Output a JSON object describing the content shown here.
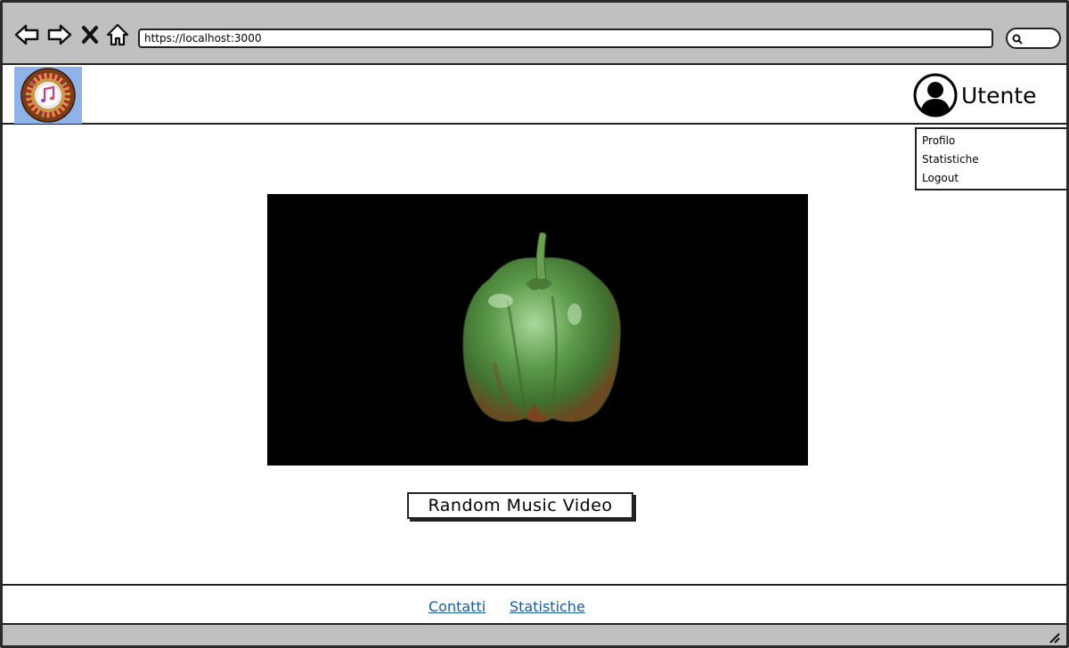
{
  "browser": {
    "url": "https://localhost:3000",
    "icons": [
      "back-arrow-icon",
      "forward-arrow-icon",
      "close-icon",
      "home-icon",
      "search-icon"
    ]
  },
  "header": {
    "logo_icon": "music-roulette-logo",
    "user_label": "Utente"
  },
  "user_menu": {
    "items": [
      "Profilo",
      "Statistiche",
      "Logout"
    ]
  },
  "main": {
    "random_button_label": "Random Music Video"
  },
  "footer": {
    "links": [
      "Contatti",
      "Statistiche"
    ]
  },
  "colors": {
    "chrome": "#c0c0c0",
    "link": "#1a5a9a",
    "logo_bg": "#8fb3e8",
    "video_bg": "#000000"
  }
}
